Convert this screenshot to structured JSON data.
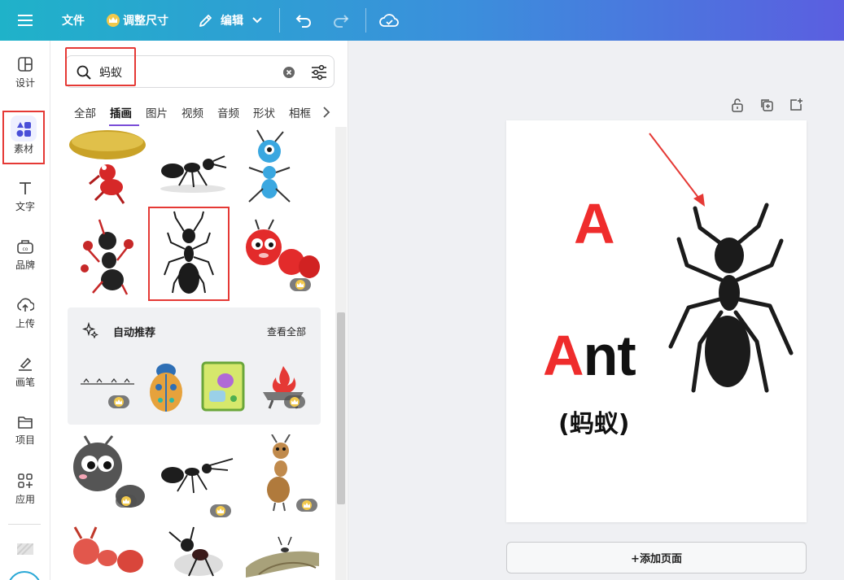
{
  "topbar": {
    "file": "文件",
    "resize": "调整尺寸",
    "edit": "编辑"
  },
  "rail": {
    "items": [
      {
        "label": "设计"
      },
      {
        "label": "素材"
      },
      {
        "label": "文字"
      },
      {
        "label": "品牌"
      },
      {
        "label": "上传"
      },
      {
        "label": "画笔"
      },
      {
        "label": "项目"
      },
      {
        "label": "应用"
      }
    ]
  },
  "search": {
    "value": "蚂蚁"
  },
  "tabs": [
    "全部",
    "插画",
    "图片",
    "视频",
    "音频",
    "形状",
    "相框"
  ],
  "recommend": {
    "title": "自动推荐",
    "view_all": "查看全部"
  },
  "canvas": {
    "letter": "A",
    "word_first": "A",
    "word_rest": "nt",
    "chinese": "(蚂蚁)",
    "add_page": "+添加页面"
  },
  "colors": {
    "accent_red": "#ef2c2c",
    "tab_underline": "#7a4dd8",
    "highlight_box": "#e53935"
  }
}
